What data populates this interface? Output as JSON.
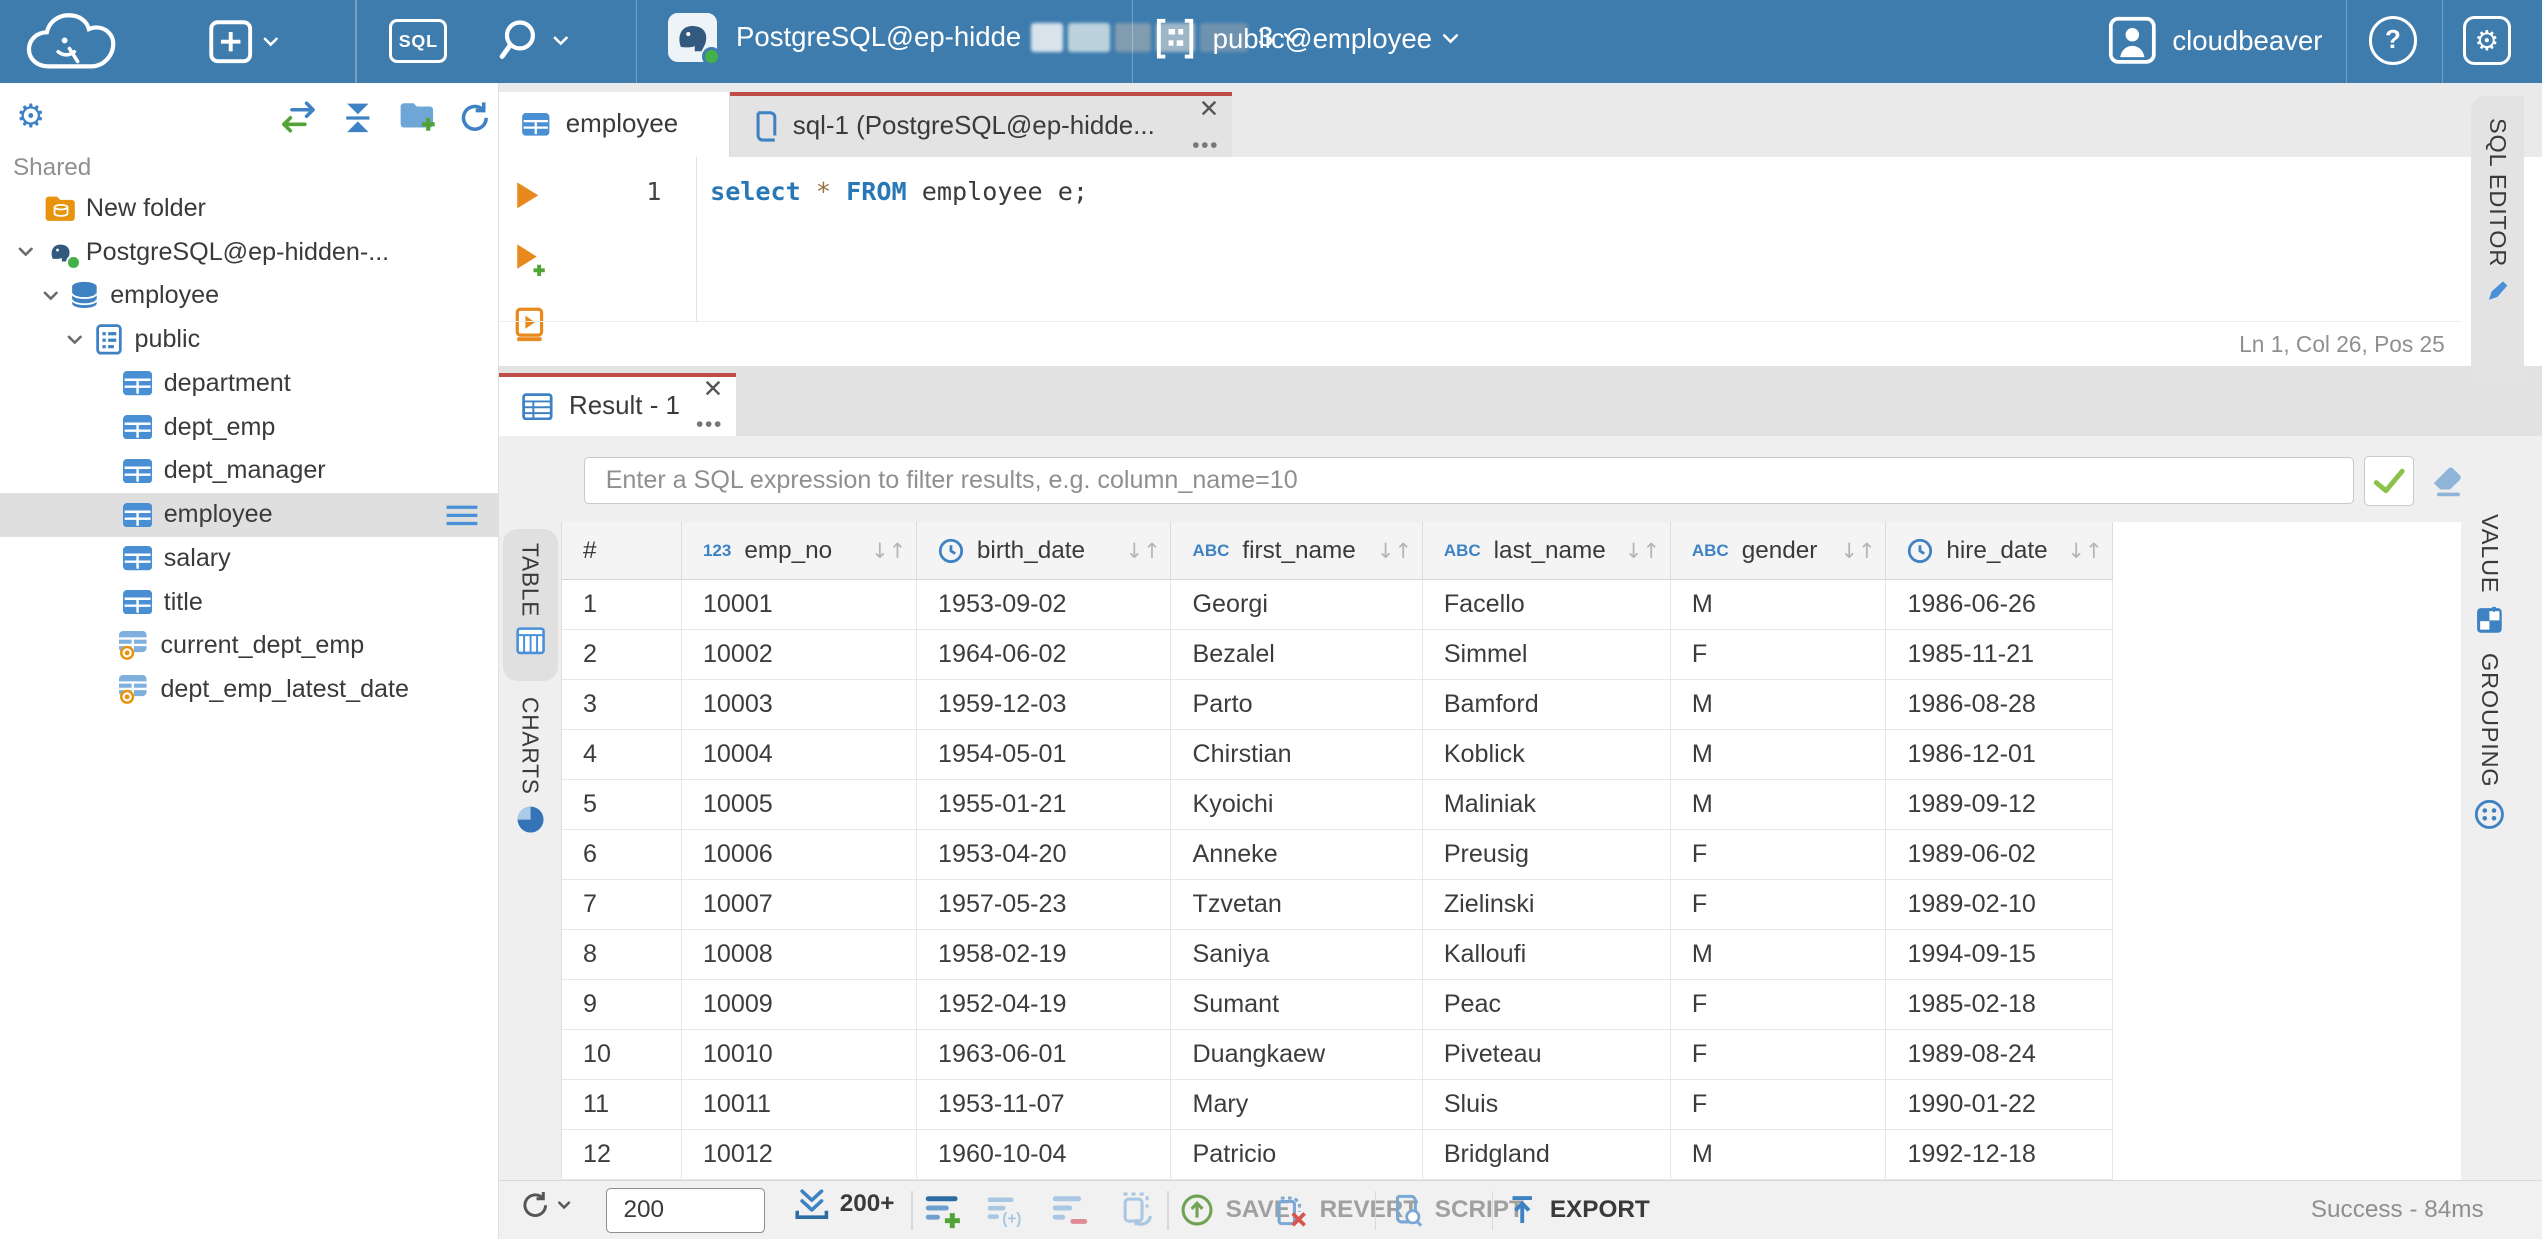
{
  "topbar": {
    "sql_button": "SQL",
    "connection": {
      "label": "PostgreSQL@ep-hidde",
      "suffix": "3"
    },
    "schema_label": "public@employee",
    "user_name": "cloudbeaver",
    "help": "?"
  },
  "sidebar": {
    "section_label": "Shared",
    "tree": [
      {
        "label": "New folder",
        "type": "folder"
      },
      {
        "label": "PostgreSQL@ep-hidden-...",
        "type": "connection",
        "expanded": true
      },
      {
        "label": "employee",
        "type": "database",
        "expanded": true
      },
      {
        "label": "public",
        "type": "schema",
        "expanded": true
      },
      {
        "label": "department",
        "type": "table"
      },
      {
        "label": "dept_emp",
        "type": "table"
      },
      {
        "label": "dept_manager",
        "type": "table"
      },
      {
        "label": "employee",
        "type": "table",
        "selected": true
      },
      {
        "label": "salary",
        "type": "table"
      },
      {
        "label": "title",
        "type": "table"
      },
      {
        "label": "current_dept_emp",
        "type": "view"
      },
      {
        "label": "dept_emp_latest_date",
        "type": "view"
      }
    ]
  },
  "tabs": {
    "editor": [
      {
        "label": "employee"
      },
      {
        "label": "sql-1 (PostgreSQL@ep-hidde...",
        "active": true
      }
    ],
    "result": {
      "label": "Result - 1"
    }
  },
  "editor": {
    "line_number": "1",
    "code": {
      "keyword1": "select",
      "star": "*",
      "keyword2": "FROM",
      "tail": " employee e;"
    },
    "status": "Ln 1, Col 26, Pos 25"
  },
  "vertical_tabs": {
    "sql_editor": "SQL EDITOR",
    "table": "TABLE",
    "charts": "CHARTS",
    "value": "VALUE",
    "grouping": "GROUPING"
  },
  "results": {
    "filter_placeholder": "Enter a SQL expression to filter results, e.g. column_name=10",
    "grid": {
      "columns": [
        {
          "name": "#",
          "type": null
        },
        {
          "name": "emp_no",
          "type": "123"
        },
        {
          "name": "birth_date",
          "type": "clock"
        },
        {
          "name": "first_name",
          "type": "ABC"
        },
        {
          "name": "last_name",
          "type": "ABC"
        },
        {
          "name": "gender",
          "type": "ABC"
        },
        {
          "name": "hire_date",
          "type": "clock"
        }
      ],
      "rows": [
        [
          "1",
          "10001",
          "1953-09-02",
          "Georgi",
          "Facello",
          "M",
          "1986-06-26"
        ],
        [
          "2",
          "10002",
          "1964-06-02",
          "Bezalel",
          "Simmel",
          "F",
          "1985-11-21"
        ],
        [
          "3",
          "10003",
          "1959-12-03",
          "Parto",
          "Bamford",
          "M",
          "1986-08-28"
        ],
        [
          "4",
          "10004",
          "1954-05-01",
          "Chirstian",
          "Koblick",
          "M",
          "1986-12-01"
        ],
        [
          "5",
          "10005",
          "1955-01-21",
          "Kyoichi",
          "Maliniak",
          "M",
          "1989-09-12"
        ],
        [
          "6",
          "10006",
          "1953-04-20",
          "Anneke",
          "Preusig",
          "F",
          "1989-06-02"
        ],
        [
          "7",
          "10007",
          "1957-05-23",
          "Tzvetan",
          "Zielinski",
          "F",
          "1989-02-10"
        ],
        [
          "8",
          "10008",
          "1958-02-19",
          "Saniya",
          "Kalloufi",
          "M",
          "1994-09-15"
        ],
        [
          "9",
          "10009",
          "1952-04-19",
          "Sumant",
          "Peac",
          "F",
          "1985-02-18"
        ],
        [
          "10",
          "10010",
          "1963-06-01",
          "Duangkaew",
          "Piveteau",
          "F",
          "1989-08-24"
        ],
        [
          "11",
          "10011",
          "1953-11-07",
          "Mary",
          "Sluis",
          "F",
          "1990-01-22"
        ],
        [
          "12",
          "10012",
          "1960-10-04",
          "Patricio",
          "Bridgland",
          "M",
          "1992-12-18"
        ]
      ]
    },
    "toolbar": {
      "row_limit": "200",
      "fetch_more": "200+",
      "save": "SAVE",
      "revert": "REVERT",
      "script": "SCRIPT",
      "export": "EXPORT",
      "status": "Success - 84ms"
    }
  },
  "colors": {
    "topbar_bg": "#3e7cae",
    "accent_blue": "#3e82c4",
    "tab_accent_red": "#bf4e49",
    "success_green": "#52a336",
    "exec_orange": "#e8891d",
    "selected_row_bg": "#dfdfdf"
  }
}
